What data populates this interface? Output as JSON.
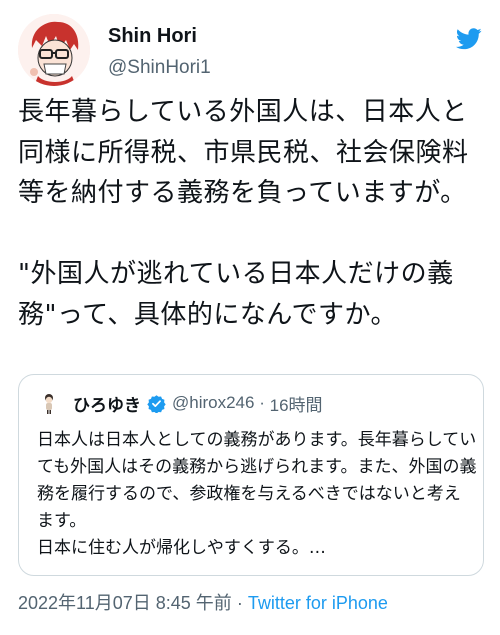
{
  "author": {
    "display_name": "Shin Hori",
    "handle": "@ShinHori1",
    "avatar_icon": "caricature-avatar-icon"
  },
  "tweet": {
    "text": "長年暮らしている外国人は、日本人と同様に所得税、市県民税、社会保険料等を納付する義務を負っていますが。\n\n\"外国人が逃れている日本人だけの義務\"って、具体的になんですか。"
  },
  "quoted": {
    "display_name": "ひろゆき",
    "handle": "@hirox246",
    "separator": "·",
    "time": "16時間",
    "text": "日本人は日本人としての義務があります。長年暮らしていても外国人はその義務から逃げられます。また、外国の義務を履行するので、参政権を与えるべきではないと考えます。\n日本に住む人が帰化しやすくする。…",
    "avatar_icon": "doll-avatar-icon",
    "verified_icon": "verified-badge-icon"
  },
  "footer": {
    "date": "2022年11月07日 8:45 午前",
    "separator": "·",
    "source": "Twitter for iPhone"
  },
  "colors": {
    "text": "#0f1419",
    "secondary": "#536471",
    "accent": "#1d9bf0",
    "border": "#cfd9de"
  },
  "icons": {
    "brand": "twitter-bird-icon"
  }
}
